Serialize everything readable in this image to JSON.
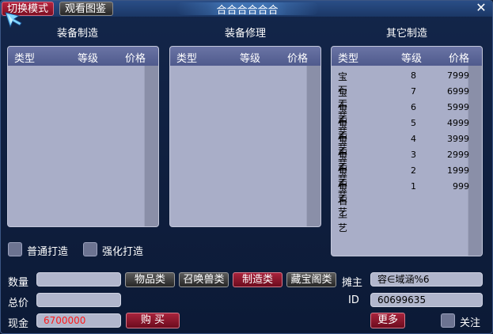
{
  "window": {
    "title": "合合合合合合",
    "switch_mode_label": "切换模式",
    "gallery_label": "观看图鉴",
    "close_label": "✕"
  },
  "sections": [
    {
      "title": "装备制造",
      "columns": [
        "类型",
        "等级",
        "价格"
      ],
      "rows": []
    },
    {
      "title": "装备修理",
      "columns": [
        "类型",
        "等级",
        "价格"
      ],
      "rows": []
    },
    {
      "title": "其它制造",
      "columns": [
        "类型",
        "等级",
        "价格"
      ],
      "rows": [
        {
          "type": "宝石工艺",
          "level": "8",
          "price": "7999"
        },
        {
          "type": "宝石工艺",
          "level": "7",
          "price": "6999"
        },
        {
          "type": "宝石工艺",
          "level": "6",
          "price": "5999"
        },
        {
          "type": "宝石工艺",
          "level": "5",
          "price": "4999"
        },
        {
          "type": "宝石工艺",
          "level": "4",
          "price": "3999"
        },
        {
          "type": "宝石工艺",
          "level": "3",
          "price": "2999"
        },
        {
          "type": "宝石工艺",
          "level": "2",
          "price": "1999"
        },
        {
          "type": "宝石工艺",
          "level": "1",
          "price": "999"
        }
      ]
    }
  ],
  "options": {
    "normal_forge_label": "普通打造",
    "enhanced_forge_label": "强化打造",
    "follow_label": "关注"
  },
  "form": {
    "quantity_label": "数量",
    "quantity_value": "",
    "total_label": "总价",
    "total_value": "",
    "cash_label": "现金",
    "cash_value": "6700000",
    "buy_label": "购 买",
    "stall_owner_label": "摊主",
    "stall_owner_value": "容∈域涵%6",
    "id_label": "ID",
    "id_value": "60699635",
    "more_label": "更多"
  },
  "categories": [
    "物品类",
    "召唤兽类",
    "制造类",
    "藏宝阁类"
  ],
  "active_category": "制造类",
  "colors": {
    "accent_red": "#8f1830",
    "panel_bg": "#a9aec8",
    "cash_text": "#ff1a1a"
  }
}
